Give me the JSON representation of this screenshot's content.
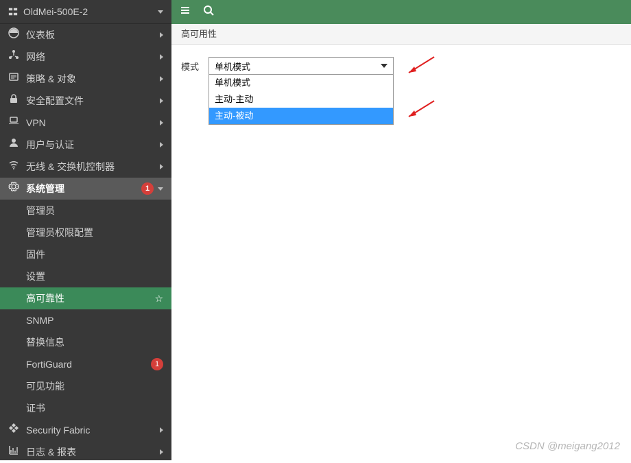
{
  "device": {
    "name": "OldMei-500E-2"
  },
  "sidebar": {
    "items": [
      {
        "label": "仪表板",
        "icon": "dashboard-icon"
      },
      {
        "label": "网络",
        "icon": "network-icon"
      },
      {
        "label": "策略 & 对象",
        "icon": "policy-icon"
      },
      {
        "label": "安全配置文件",
        "icon": "lock-icon"
      },
      {
        "label": "VPN",
        "icon": "laptop-icon"
      },
      {
        "label": "用户与认证",
        "icon": "user-icon"
      },
      {
        "label": "无线 & 交换机控制器",
        "icon": "wifi-icon"
      },
      {
        "label": "系统管理",
        "icon": "gear-icon",
        "badge": "1",
        "expanded": true
      },
      {
        "label": "Security Fabric",
        "icon": "fabric-icon"
      },
      {
        "label": "日志 & 报表",
        "icon": "chart-icon"
      }
    ],
    "sub_items": [
      {
        "label": "管理员"
      },
      {
        "label": "管理员权限配置"
      },
      {
        "label": "固件"
      },
      {
        "label": "设置"
      },
      {
        "label": "高可靠性",
        "selected": true
      },
      {
        "label": "SNMP"
      },
      {
        "label": "替换信息"
      },
      {
        "label": "FortiGuard",
        "badge": "1"
      },
      {
        "label": "可见功能"
      },
      {
        "label": "证书"
      }
    ]
  },
  "breadcrumb": {
    "title": "高可用性"
  },
  "form": {
    "mode_label": "模式",
    "mode_selected": "单机模式",
    "mode_options": [
      "单机模式",
      "主动-主动",
      "主动-被动"
    ]
  },
  "watermark": "CSDN @meigang2012"
}
